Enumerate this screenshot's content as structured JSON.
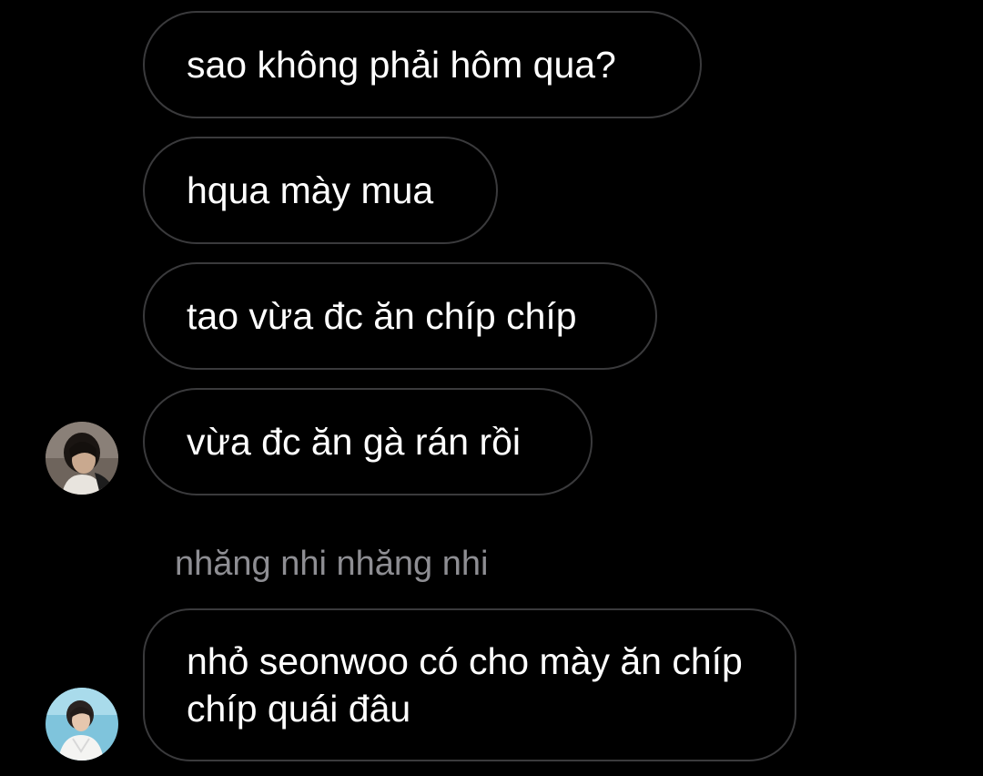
{
  "chat": {
    "messages": [
      {
        "text": "sao không phải hôm qua?"
      },
      {
        "text": "hqua mày mua"
      },
      {
        "text": "tao vừa đc ăn chíp chíp"
      },
      {
        "text": "vừa đc ăn gà rán rồi"
      },
      {
        "sender": "nhăng nhi nhăng nhi",
        "text": "nhỏ seonwoo có cho mày ăn chíp chíp quái đâu"
      }
    ]
  },
  "colors": {
    "background": "#000000",
    "bubble_border": "#3a3a3c",
    "message_text": "#ffffff",
    "sender_name": "#8e8e93"
  },
  "icons": {
    "avatar_1": "user-avatar-photo-dark",
    "avatar_2": "user-avatar-photo-blue"
  }
}
